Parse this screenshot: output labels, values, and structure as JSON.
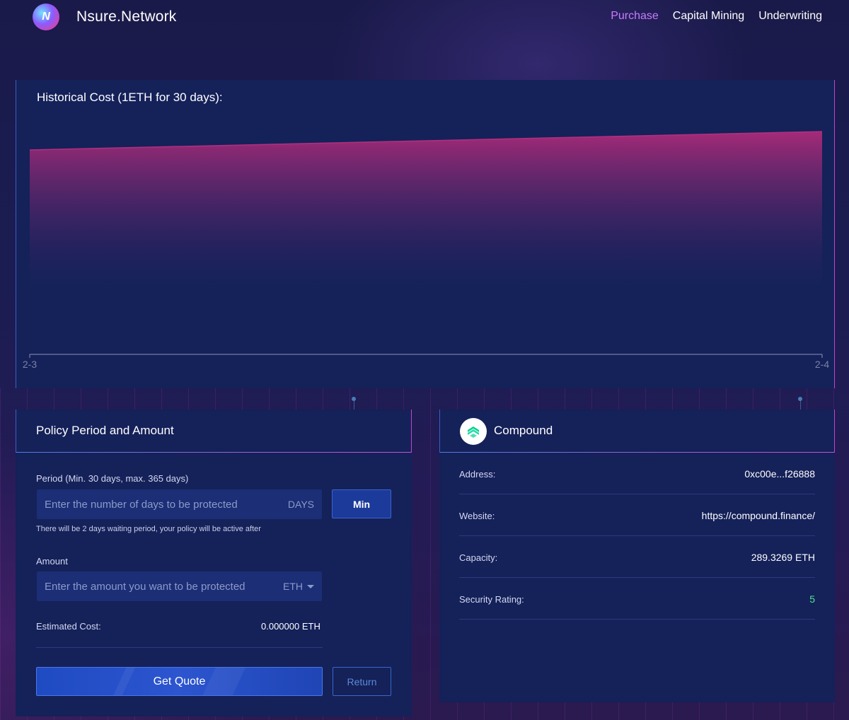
{
  "header": {
    "brand": "Nsure.Network",
    "logo_icon": "nsure-logo-icon",
    "nav": [
      {
        "label": "Purchase",
        "active": true
      },
      {
        "label": "Capital Mining",
        "active": false
      },
      {
        "label": "Underwriting",
        "active": false
      }
    ]
  },
  "chart_data": {
    "type": "area",
    "title": "Historical Cost (1ETH for 30 days):",
    "categories": [
      "2-3",
      "2-4"
    ],
    "series": [
      {
        "values": [
          1.0,
          1.12
        ]
      }
    ],
    "color": "#b0307e"
  },
  "policy": {
    "title": "Policy Period and Amount",
    "period_label": "Period (Min. 30 days, max. 365 days)",
    "period_placeholder": "Enter the number of days to be protected",
    "period_value": "",
    "period_unit": "DAYS",
    "min_button": "Min",
    "waiting_hint": "There will be 2 days waiting period, your policy will be active after",
    "amount_label": "Amount",
    "amount_placeholder": "Enter the amount you want to be protected",
    "amount_value": "",
    "amount_unit": "ETH",
    "estimated_label": "Estimated Cost:",
    "estimated_value": "0.000000 ETH",
    "quote_button": "Get Quote",
    "return_button": "Return"
  },
  "protocol": {
    "name": "Compound",
    "icon": "compound-logo-icon",
    "rows": [
      {
        "key": "Address:",
        "value": "0xc00e...f26888"
      },
      {
        "key": "Website:",
        "value": "https://compound.finance/"
      },
      {
        "key": "Capacity:",
        "value": "289.3269 ETH"
      },
      {
        "key": "Security Rating:",
        "value": "5"
      }
    ],
    "rating_color": "#4ee48f"
  }
}
